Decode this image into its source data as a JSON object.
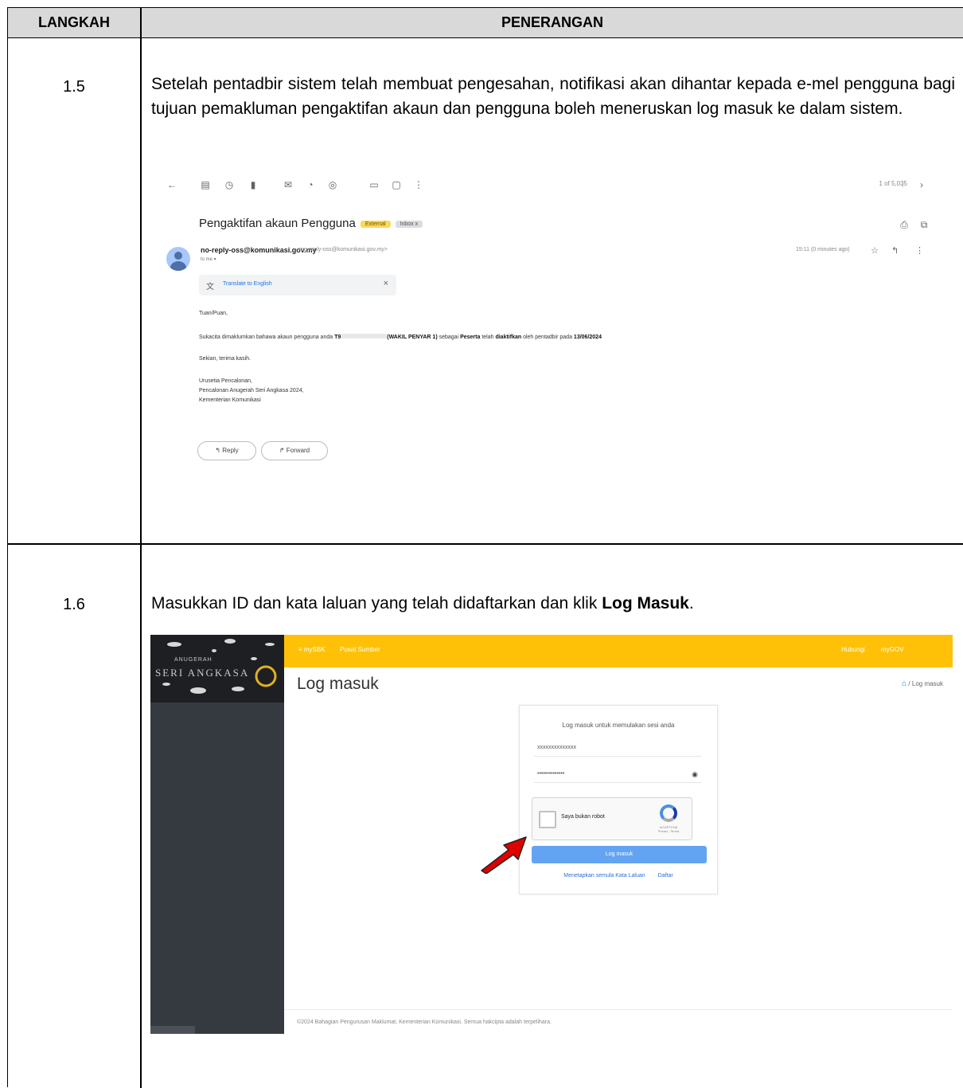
{
  "table": {
    "col_step": "LANGKAH",
    "col_desc": "PENERANGAN"
  },
  "steps": [
    {
      "number": "1.5",
      "text": "Setelah pentadbir sistem telah membuat pengesahan, notifikasi akan dihantar kepada e-mel pengguna bagi tujuan pemakluman pengaktifan akaun dan pengguna boleh meneruskan log masuk ke dalam sistem."
    },
    {
      "number": "1.6",
      "text_before": "Masukkan ID dan kata laluan yang telah didaftarkan dan klik ",
      "text_bold": "Log Masuk",
      "text_after": "."
    }
  ],
  "email": {
    "pager": "1 of 5,035",
    "subject": "Pengaktifan akaun Pengguna",
    "badge_external": "External",
    "badge_inbox": "Inbox x",
    "sender_name": "no-reply-oss@komunikasi.gov.my",
    "sender_email": "<no-reply-oss@komunikasi.gov.my>",
    "to_me": "to me ▾",
    "time": "15:11 (0 minutes ago)",
    "translate_label": "Translate to English",
    "greeting": "Tuan/Puan,",
    "body_pre": "Sukacita dimaklumkan bahawa akaun pengguna anda ",
    "body_id": "T9",
    "body_role": "(WAKIL PENYAR 1)",
    "body_mid": " sebagai ",
    "body_peserta": "Peserta",
    "body_mid2": " telah ",
    "body_active": "diaktifkan",
    "body_post": " oleh pentadbir pada ",
    "body_date": "13/06/2024",
    "closing": "Sekian, terima kasih.",
    "sig_1": "Urusetia Pencalonan,",
    "sig_2": "Pencalonan Anugerah Seri Angkasa 2024,",
    "sig_3": "Kementerian Komunikasi",
    "reply_button": "↰ Reply",
    "forward_button": "↱ Forward"
  },
  "login": {
    "logo_text": "SERI ANGKASA",
    "logo_sub": "ANUGERAH",
    "topbar_brand": "≡  mySBK",
    "topbar_menu": "Pusat Sumber",
    "topbar_right_1": "Hubungi",
    "topbar_right_2": "myGOV",
    "page_title": "Log masuk",
    "breadcrumb": "/ Log masuk",
    "card_heading": "Log masuk untuk memulakan sesi anda",
    "username_value": "xxxxxxxxxxxxxx",
    "password_value": "••••••••••••••",
    "captcha_label": "Saya bukan robot",
    "captcha_brand": "reCAPTCHA",
    "captcha_small": "Privasi - Terma",
    "submit_label": "Log masuk",
    "forgot_link": "Menetapkan semula Kata Laluan",
    "register_link": "Daftar",
    "footer": "©2024 Bahagian Pengurusan Maklumat, Kementerian Komunikasi. Semua hakcipta adalah terpelihara."
  }
}
